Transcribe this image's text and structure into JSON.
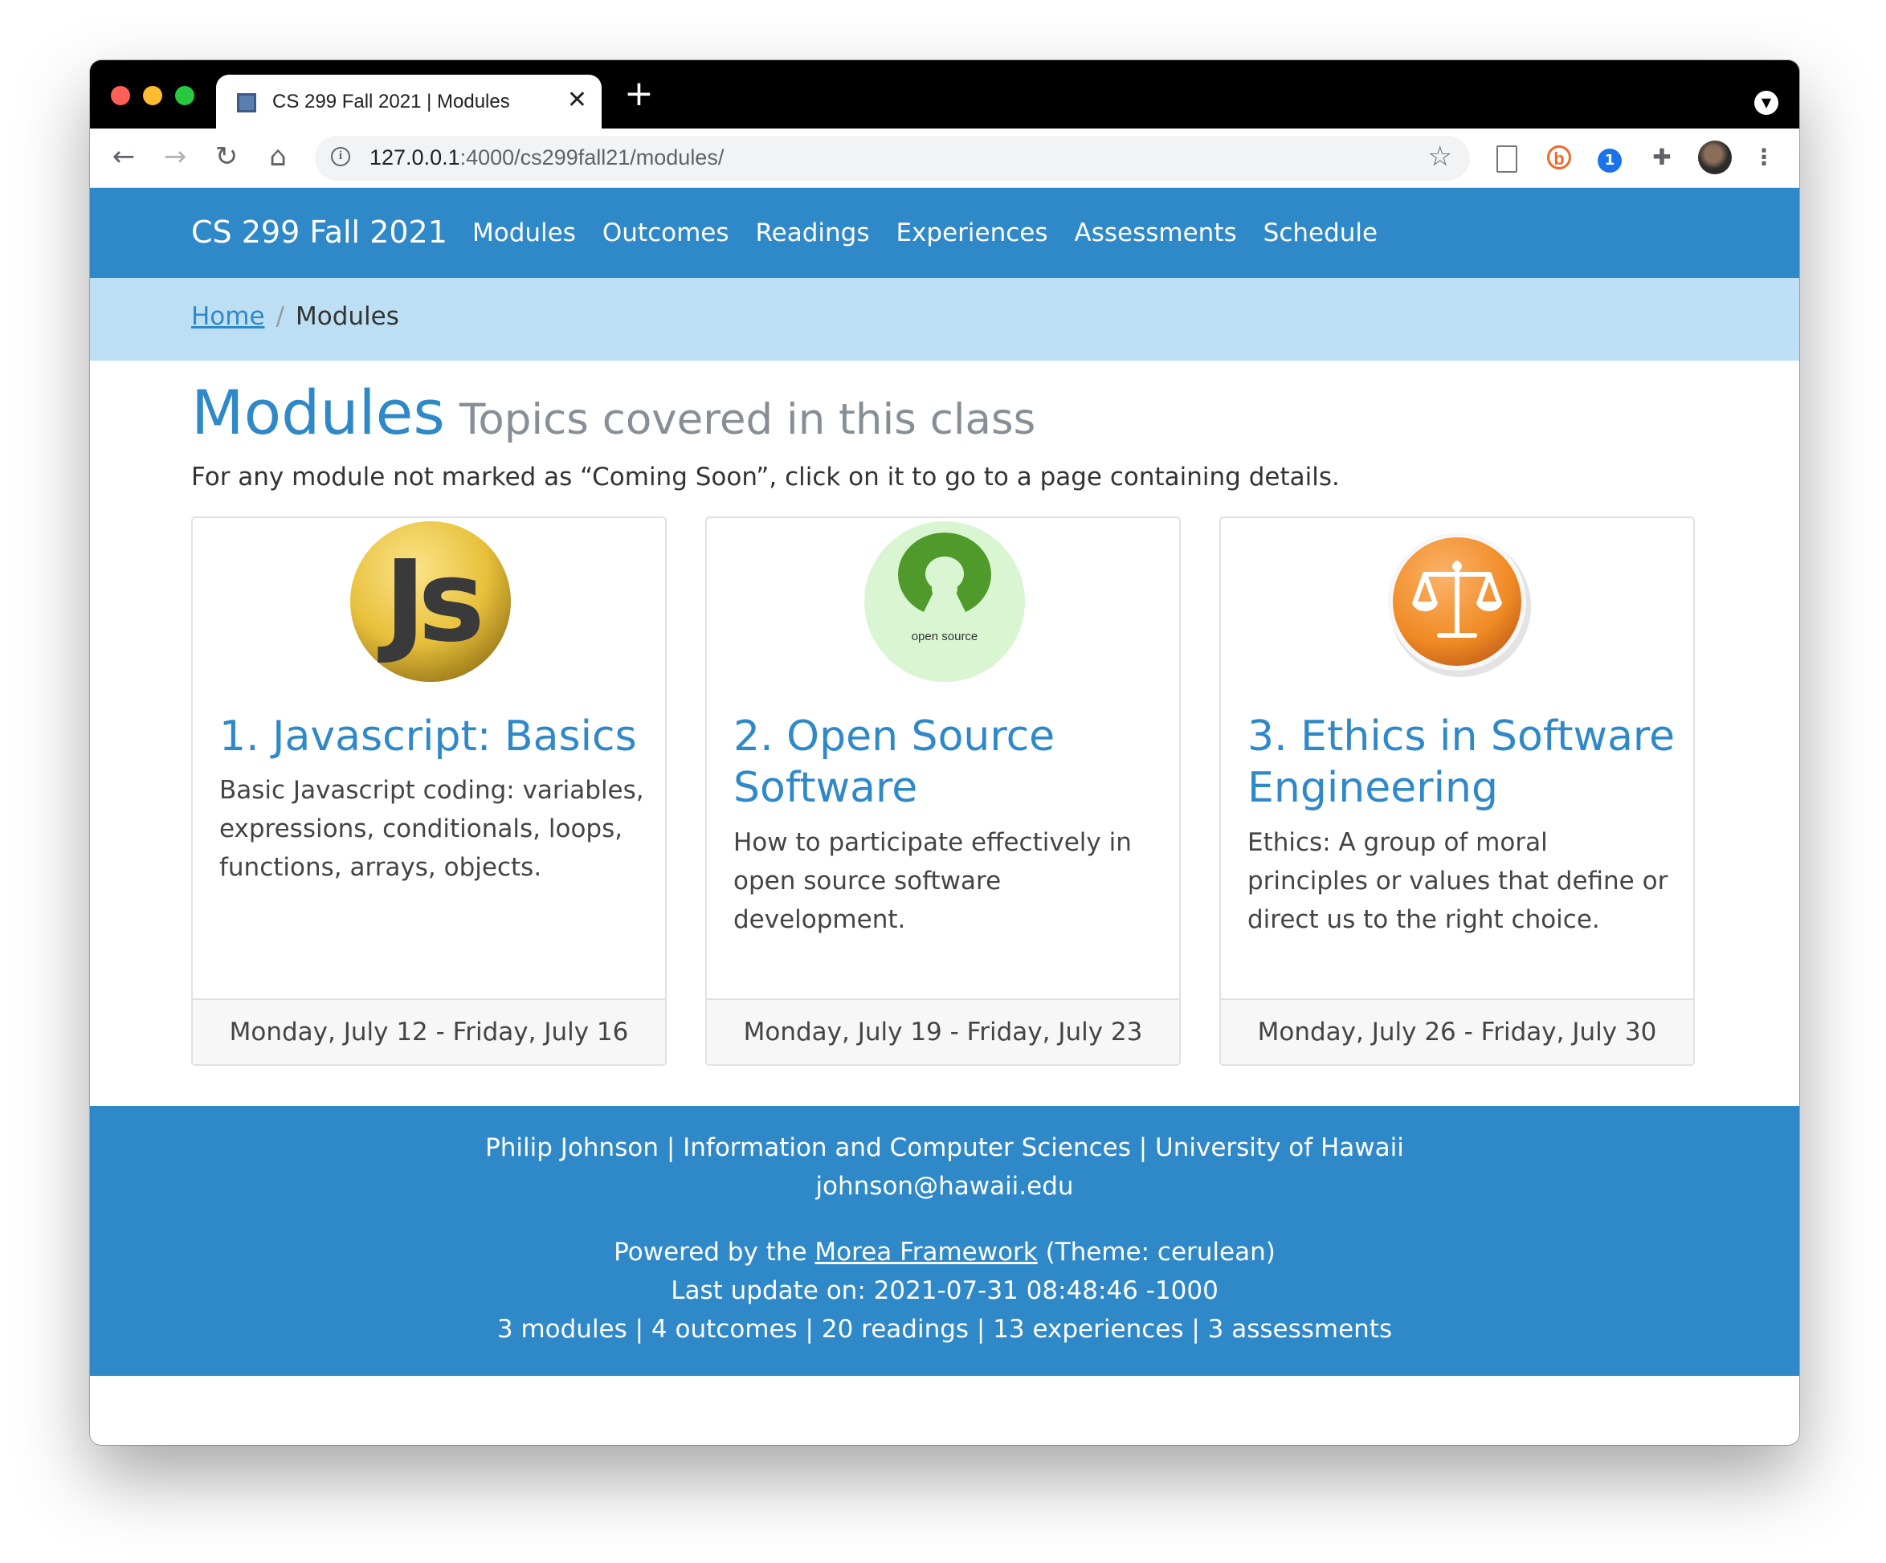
{
  "browser": {
    "tab_title": "CS 299 Fall 2021 | Modules",
    "tab_close": "✕",
    "new_tab": "+",
    "url_host": "127.0.0.1",
    "url_rest": ":4000/cs299fall21/modules/"
  },
  "navbar": {
    "brand": "CS 299 Fall 2021",
    "links": [
      "Modules",
      "Outcomes",
      "Readings",
      "Experiences",
      "Assessments",
      "Schedule"
    ]
  },
  "breadcrumb": {
    "home": "Home",
    "separator": "/",
    "current": "Modules"
  },
  "main": {
    "title": "Modules",
    "subtitle": "Topics covered in this class",
    "intro": "For any module not marked as “Coming Soon”, click on it to go to a page containing details."
  },
  "modules": [
    {
      "title": "1. Javascript: Basics",
      "description": "Basic Javascript coding: variables, expressions, conditionals, loops, functions, arrays, objects.",
      "dates": "Monday, July 12 - Friday, July 16",
      "icon": "javascript-logo-icon",
      "logo_text": "Js"
    },
    {
      "title": "2. Open Source Software",
      "description": "How to participate effectively in open source software development.",
      "dates": "Monday, July 19 - Friday, July 23",
      "icon": "open-source-logo-icon",
      "logo_text": "open source"
    },
    {
      "title": "3. Ethics in Software Engineering",
      "description": "Ethics: A group of moral principles or values that define or direct us to the right choice.",
      "dates": "Monday, July 26 - Friday, July 30",
      "icon": "scales-of-justice-icon"
    }
  ],
  "footer": {
    "line1": "Philip Johnson | Information and Computer Sciences | University of Hawaii",
    "email": "johnson@hawaii.edu",
    "powered_prefix": "Powered by the ",
    "powered_link": "Morea Framework",
    "powered_suffix": " (Theme: cerulean)",
    "last_update": "Last update on: 2021-07-31 08:48:46 -1000",
    "stats": "3 modules | 4 outcomes | 20 readings | 13 experiences | 3 assessments"
  },
  "colors": {
    "primary": "#2f89c8",
    "breadcrumb_bg": "#bddff4",
    "js_logo_yellow": "#e8c13b",
    "open_source_green": "#4f9a2b",
    "ethics_orange": "#f08a24"
  }
}
